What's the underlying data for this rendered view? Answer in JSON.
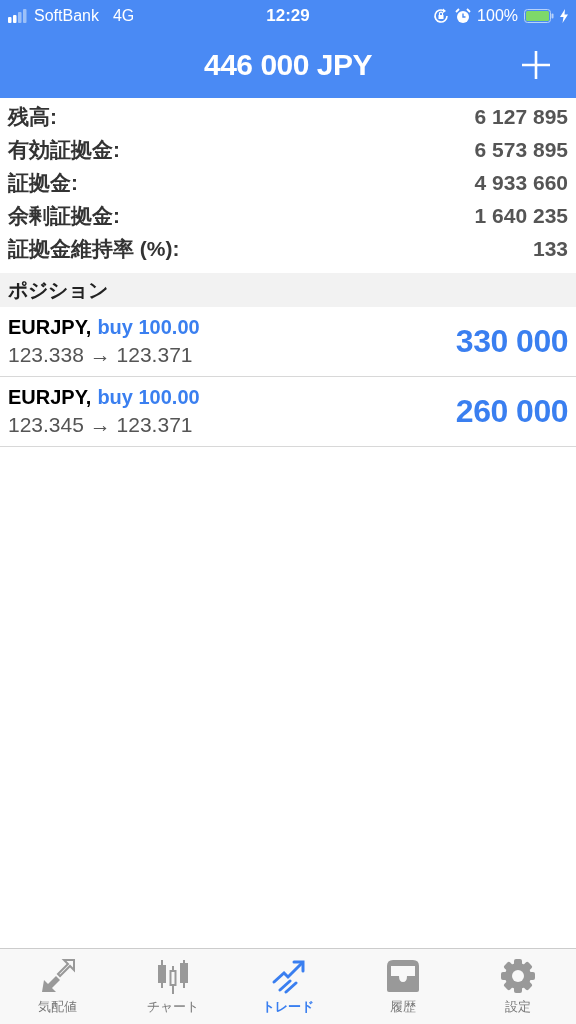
{
  "status_bar": {
    "carrier": "SoftBank",
    "network": "4G",
    "time": "12:29",
    "battery": "100%"
  },
  "header": {
    "title": "446 000 JPY"
  },
  "summary": [
    {
      "label": "残高:",
      "value": "6 127 895"
    },
    {
      "label": "有効証拠金:",
      "value": "6 573 895"
    },
    {
      "label": "証拠金:",
      "value": "4 933 660"
    },
    {
      "label": "余剰証拠金:",
      "value": "1 640 235"
    },
    {
      "label": "証拠金維持率 (%):",
      "value": "133"
    }
  ],
  "positions_section": {
    "title": "ポジション"
  },
  "positions": [
    {
      "symbol": "EURJPY,",
      "order": "buy 100.00",
      "prices": "123.338 → 123.371",
      "profit": "330 000"
    },
    {
      "symbol": "EURJPY,",
      "order": "buy 100.00",
      "prices": "123.345 → 123.371",
      "profit": "260 000"
    }
  ],
  "tabs": [
    {
      "label": "気配値",
      "selected": false
    },
    {
      "label": "チャート",
      "selected": false
    },
    {
      "label": "トレード",
      "selected": true
    },
    {
      "label": "履歴",
      "selected": false
    },
    {
      "label": "設定",
      "selected": false
    }
  ]
}
